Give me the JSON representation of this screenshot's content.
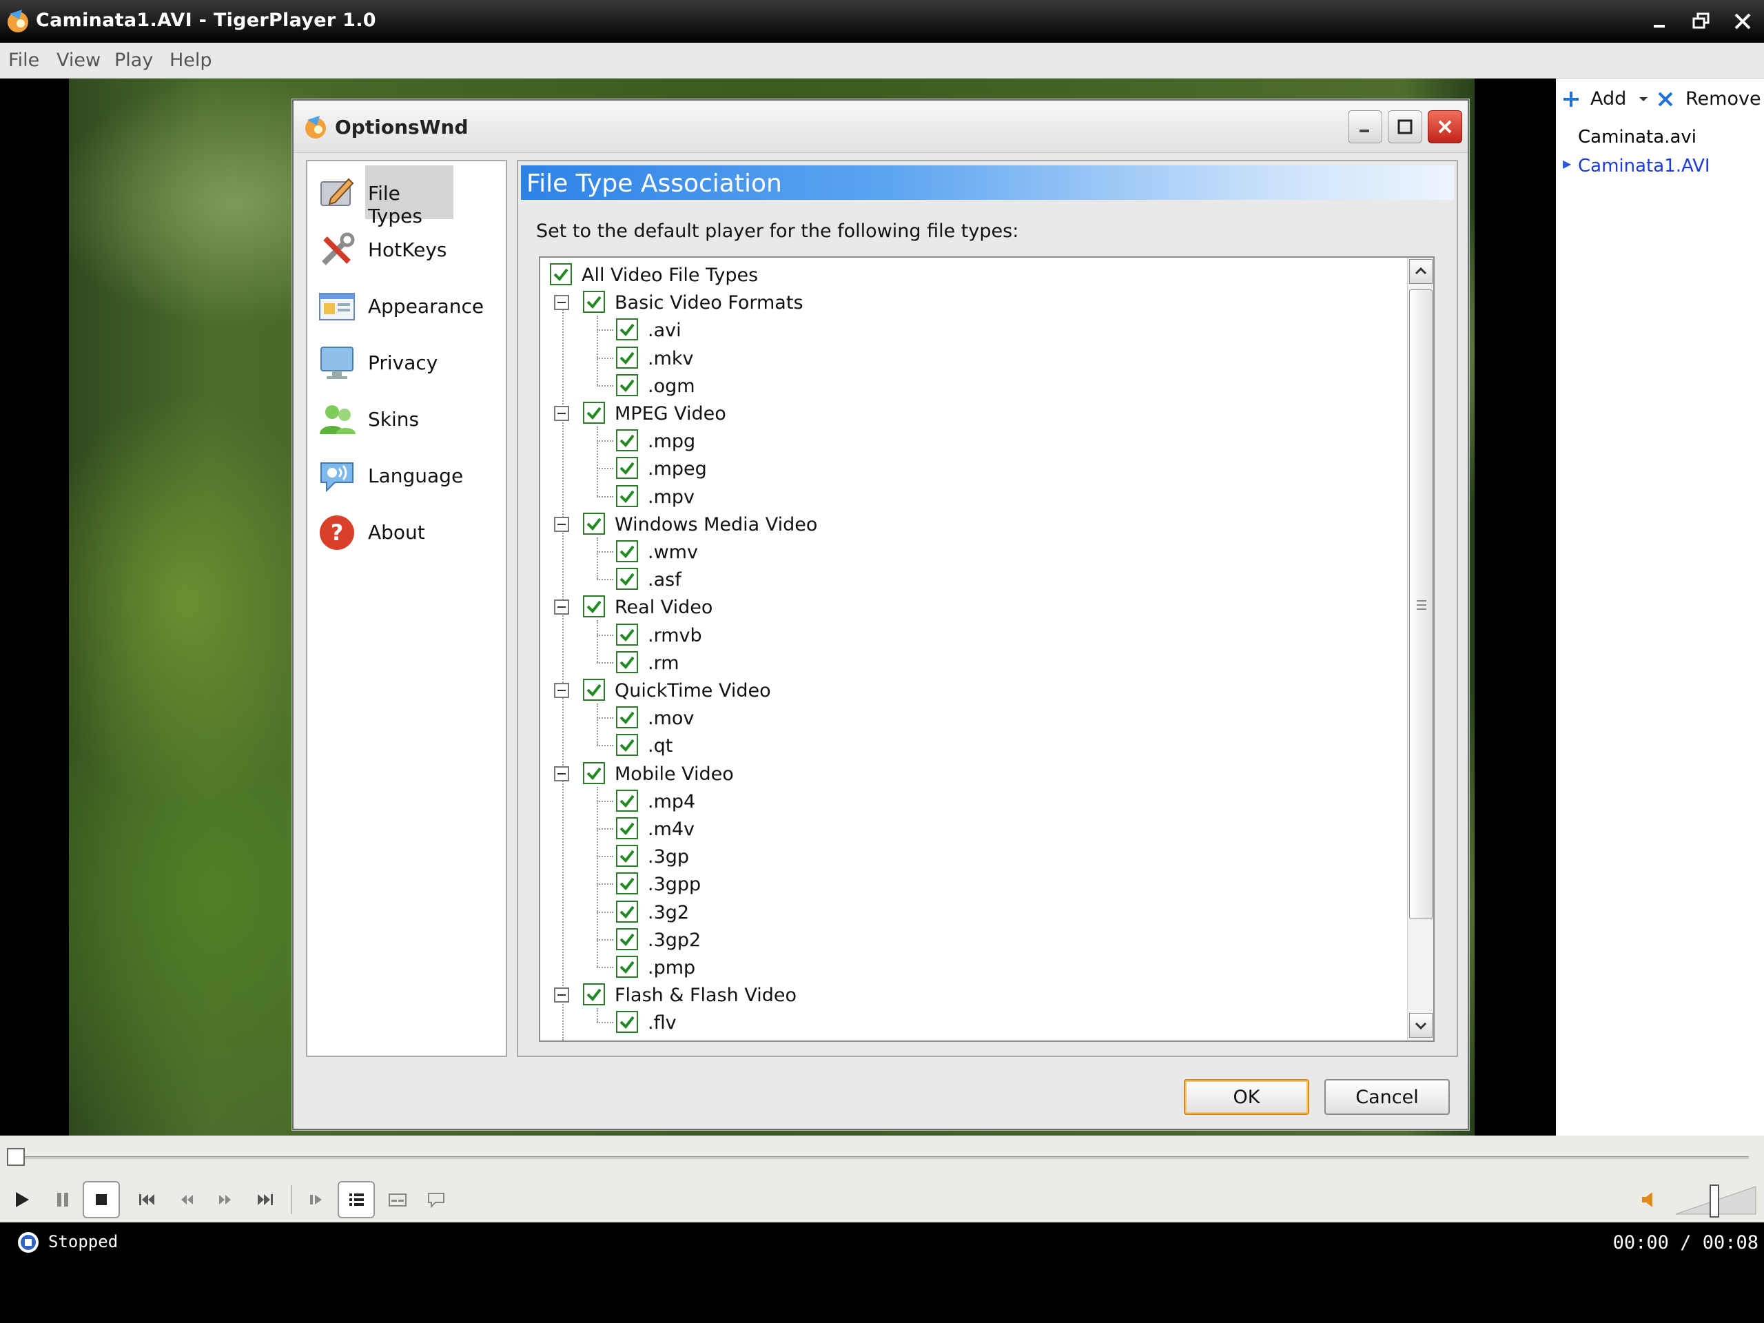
{
  "window": {
    "title": "Caminata1.AVI - TigerPlayer 1.0"
  },
  "menu": [
    "File",
    "View",
    "Play",
    "Help"
  ],
  "playlist": {
    "add_label": "Add",
    "remove_label": "Remove",
    "items": [
      {
        "name": "Caminata.avi",
        "current": false
      },
      {
        "name": "Caminata1.AVI",
        "current": true
      }
    ]
  },
  "dialog": {
    "title": "OptionsWnd",
    "nav": [
      {
        "label": "File Types",
        "icon": "file-types-icon",
        "active": true
      },
      {
        "label": "HotKeys",
        "icon": "hotkeys-icon",
        "active": false
      },
      {
        "label": "Appearance",
        "icon": "appearance-icon",
        "active": false
      },
      {
        "label": "Privacy",
        "icon": "privacy-icon",
        "active": false
      },
      {
        "label": "Skins",
        "icon": "skins-icon",
        "active": false
      },
      {
        "label": "Language",
        "icon": "language-icon",
        "active": false
      },
      {
        "label": "About",
        "icon": "about-icon",
        "active": false
      }
    ],
    "section_title": "File Type Association",
    "description": "Set to the default player for the following file types:",
    "tree": {
      "root_label": "All Video File Types",
      "root_checked": true,
      "groups": [
        {
          "label": "Basic Video Formats",
          "checked": true,
          "items": [
            ".avi",
            ".mkv",
            ".ogm"
          ]
        },
        {
          "label": "MPEG Video",
          "checked": true,
          "items": [
            ".mpg",
            ".mpeg",
            ".mpv"
          ]
        },
        {
          "label": "Windows Media Video",
          "checked": true,
          "items": [
            ".wmv",
            ".asf"
          ]
        },
        {
          "label": "Real Video",
          "checked": true,
          "items": [
            ".rmvb",
            ".rm"
          ]
        },
        {
          "label": "QuickTime Video",
          "checked": true,
          "items": [
            ".mov",
            ".qt"
          ]
        },
        {
          "label": "Mobile Video",
          "checked": true,
          "items": [
            ".mp4",
            ".m4v",
            ".3gp",
            ".3gpp",
            ".3g2",
            ".3gp2",
            ".pmp"
          ]
        },
        {
          "label": "Flash & Flash Video",
          "checked": true,
          "items": [
            ".flv"
          ]
        }
      ]
    },
    "ok_label": "OK",
    "cancel_label": "Cancel"
  },
  "player": {
    "status": "Stopped",
    "current_time": "00:00",
    "total_time": "00:08",
    "seek_position": 0
  },
  "colors": {
    "section_header": "#2d82e6",
    "check": "#1f8a1f",
    "playlist_current": "#1a3adf"
  }
}
